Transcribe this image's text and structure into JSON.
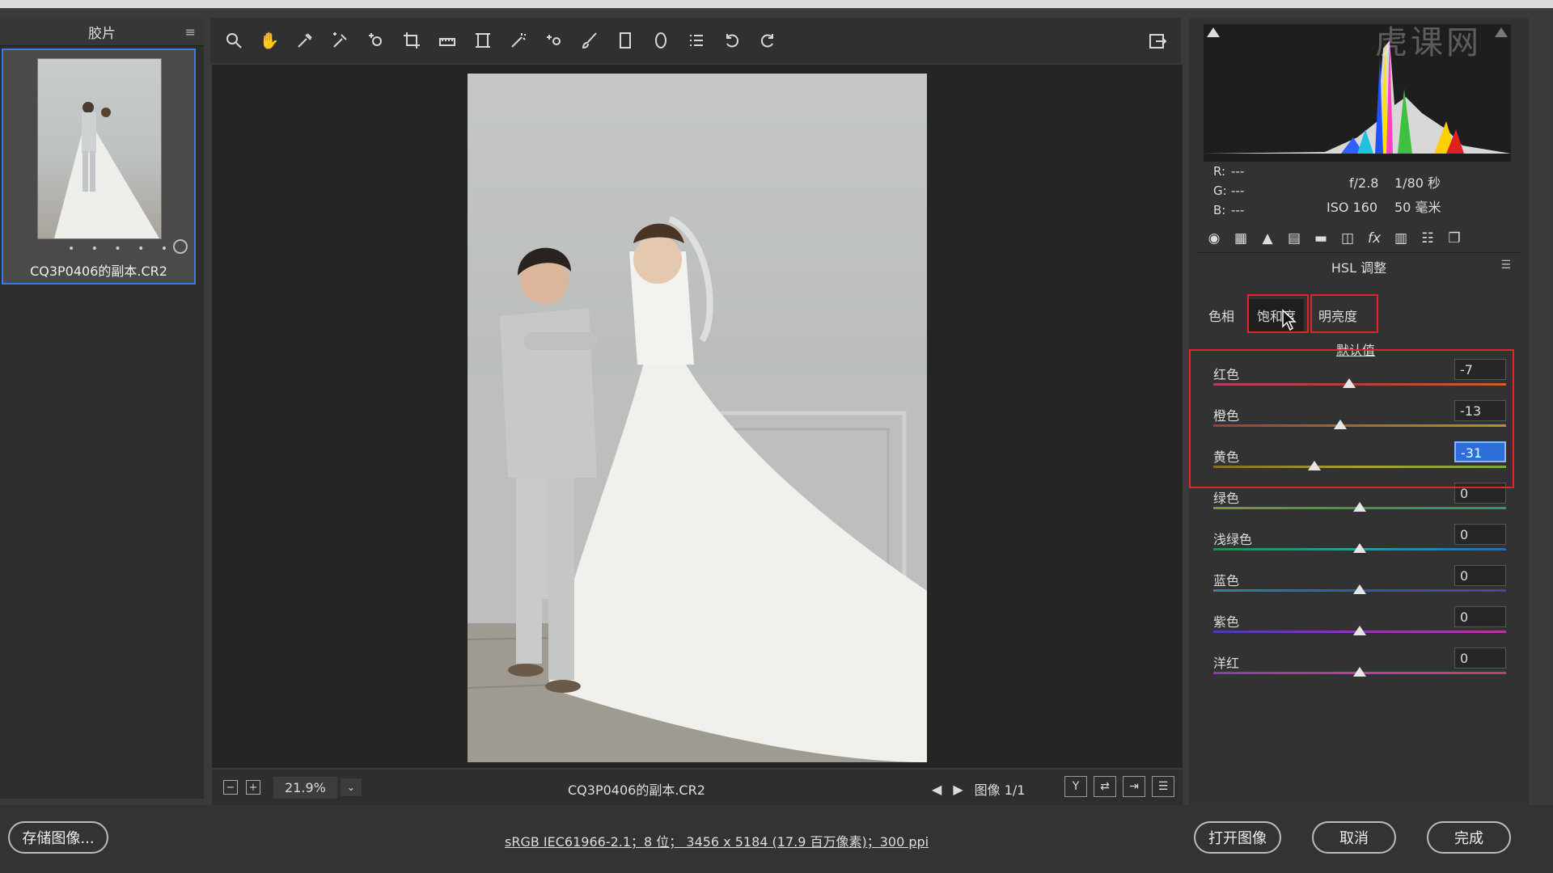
{
  "filmstrip": {
    "title": "胶片",
    "filename": "CQ3P0406的副本.CR2",
    "dots": "• • • • •"
  },
  "toolbar": {
    "tools": [
      "zoom-tool",
      "hand-tool",
      "white-balance-tool",
      "color-sampler-tool",
      "targeted-adjustment-tool",
      "crop-tool",
      "straighten-tool",
      "transform-tool",
      "spot-removal-tool",
      "red-eye-tool",
      "adjustment-brush-tool",
      "graduated-filter-tool",
      "radial-filter-tool",
      "preferences-tool",
      "rotate-left-tool",
      "rotate-right-tool"
    ]
  },
  "status": {
    "zoom": "21.9%",
    "filename": "CQ3P0406的副本.CR2",
    "image_index": "图像 1/1"
  },
  "histogram": {
    "r": "---",
    "g": "---",
    "b": "---",
    "aperture": "f/2.8",
    "shutter": "1/80 秒",
    "iso": "ISO 160",
    "focal": "50 毫米"
  },
  "panel": {
    "title": "HSL 调整",
    "subtabs": [
      "色相",
      "饱和度",
      "明亮度"
    ],
    "default_link": "默认值",
    "sliders": [
      {
        "label": "红色",
        "value": "-7",
        "pos": 0.465,
        "colors": [
          "#b0405a",
          "#b04040",
          "#c86030"
        ]
      },
      {
        "label": "橙色",
        "value": "-13",
        "pos": 0.435,
        "colors": [
          "#9a4030",
          "#a86a2a",
          "#b89030"
        ]
      },
      {
        "label": "黄色",
        "value": "-31",
        "pos": 0.345,
        "colors": [
          "#8a6a2a",
          "#a8a030",
          "#7aa840"
        ]
      },
      {
        "label": "绿色",
        "value": "0",
        "pos": 0.5,
        "colors": [
          "#7a9a30",
          "#3a9a40",
          "#2a9a70"
        ]
      },
      {
        "label": "浅绿色",
        "value": "0",
        "pos": 0.5,
        "colors": [
          "#2a8a50",
          "#2a9a9a",
          "#2a6aa8"
        ]
      },
      {
        "label": "蓝色",
        "value": "0",
        "pos": 0.5,
        "colors": [
          "#2a8a9a",
          "#2a5ab0",
          "#5a3ab0"
        ]
      },
      {
        "label": "紫色",
        "value": "0",
        "pos": 0.5,
        "colors": [
          "#4a3ab0",
          "#8a3ab0",
          "#b03a9a"
        ]
      },
      {
        "label": "洋红",
        "value": "0",
        "pos": 0.5,
        "colors": [
          "#8a3ab0",
          "#c03a9a",
          "#c04060"
        ]
      }
    ]
  },
  "footer": {
    "save_label": "存储图像...",
    "info": "sRGB IEC61966-2.1；8 位； 3456 x 5184 (17.9 百万像素)；300 ppi",
    "open_label": "打开图像",
    "cancel_label": "取消",
    "done_label": "完成"
  },
  "watermark": "虎课网"
}
